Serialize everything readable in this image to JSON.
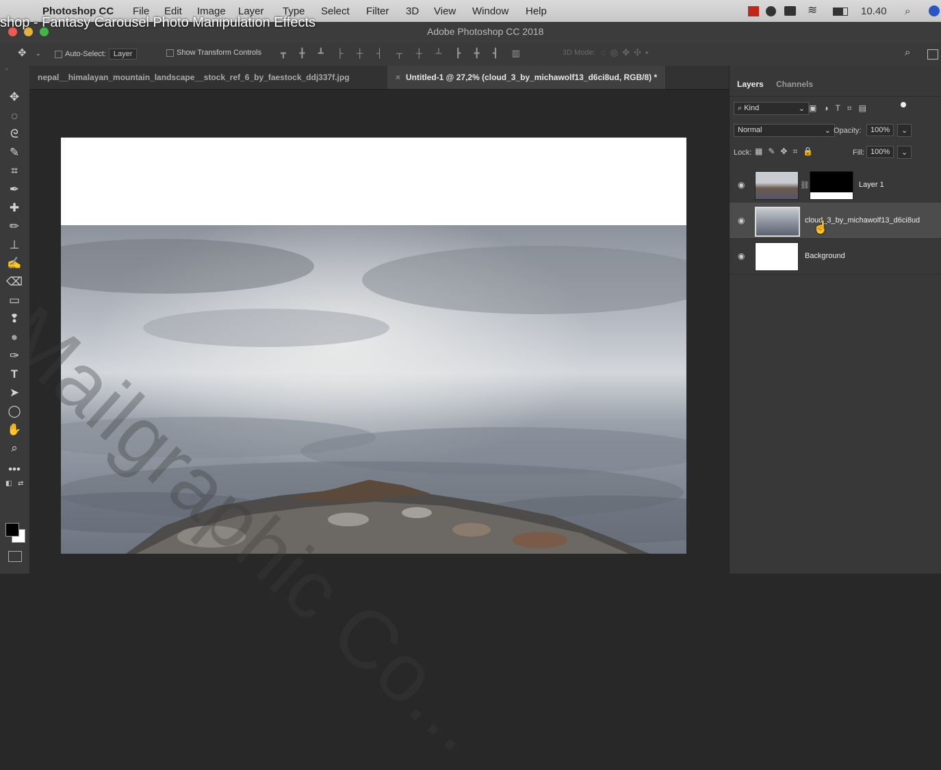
{
  "menubar": {
    "apple_icon": "apple-logo-icon",
    "app_name": "Photoshop CC",
    "menus": [
      "File",
      "Edit",
      "Image",
      "Layer",
      "Type",
      "Select",
      "Filter",
      "3D",
      "View",
      "Window",
      "Help"
    ],
    "clock": "10.40"
  },
  "video_title": "shop - Fantasy Carousel Photo Manipulation Effects",
  "window_title": "Adobe Photoshop CC 2018",
  "options": {
    "auto_select_label": "Auto-Select:",
    "auto_select_value": "Layer",
    "show_transform_label": "Show Transform Controls",
    "mode_3d_label": "3D Mode:"
  },
  "tabs": [
    {
      "label": "nepal__himalayan_mountain_landscape__stock_ref_6_by_faestock_ddj337f.jpg"
    },
    {
      "label": "Untitled-1 @ 27,2% (cloud_3_by_michawolf13_d6ci8ud, RGB/8) *"
    }
  ],
  "panel": {
    "tab_layers": "Layers",
    "tab_channels": "Channels",
    "kind_label": "Kind",
    "blend_mode": "Normal",
    "opacity_label": "Opacity:",
    "opacity_value": "100%",
    "lock_label": "Lock:",
    "fill_label": "Fill:",
    "fill_value": "100%",
    "layers": [
      {
        "name": "Layer 1"
      },
      {
        "name": "cloud_3_by_michawolf13_d6ci8ud"
      },
      {
        "name": "Background"
      }
    ]
  },
  "watermark": "Mailgraphic Co..."
}
